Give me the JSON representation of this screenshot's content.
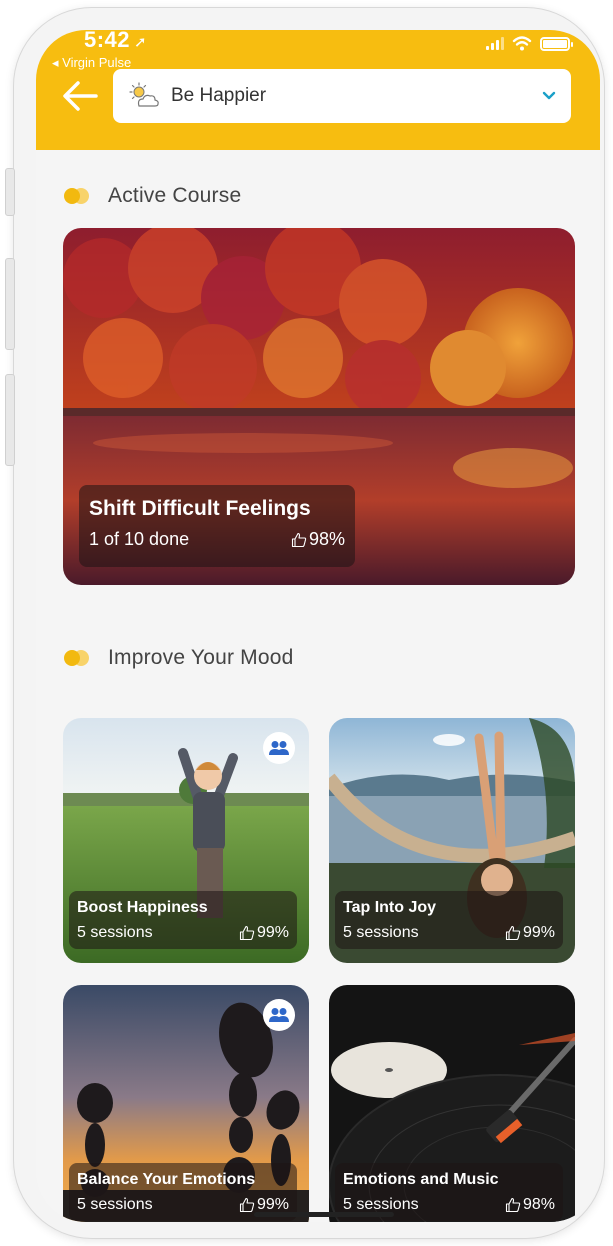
{
  "status_bar": {
    "time": "5:42",
    "back_app": "Virgin Pulse"
  },
  "header": {
    "topic_selector": {
      "value": "Be Happier",
      "icon": "partly-cloudy-icon"
    },
    "back_icon": "arrow-left-icon",
    "accent_color": "#f7bd10"
  },
  "active_section": {
    "title": "Active Course",
    "course": {
      "title": "Shift Difficult Feelings",
      "progress": "1 of 10 done",
      "rating": "98%"
    }
  },
  "mood_section": {
    "title": "Improve Your Mood",
    "courses": [
      {
        "title": "Boost Happiness",
        "sessions": "5 sessions",
        "rating": "99%",
        "group": true
      },
      {
        "title": "Tap Into Joy",
        "sessions": "5 sessions",
        "rating": "99%",
        "group": false
      },
      {
        "title": "Balance Your Emotions",
        "sessions": "5 sessions",
        "rating": "99%",
        "group": true
      },
      {
        "title": "Emotions and Music",
        "sessions": "5 sessions",
        "rating": "98%",
        "group": false
      }
    ]
  }
}
